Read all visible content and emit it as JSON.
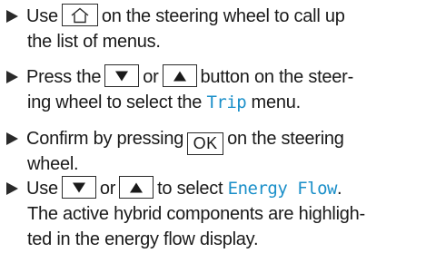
{
  "colors": {
    "text": "#1a1a1a",
    "menu_highlight": "#1a8fc9",
    "bullet": "#2a2a2a"
  },
  "steps": [
    {
      "bullet_icon": "triangle-right-icon",
      "line1_pre": "Use",
      "home_icon": "home-icon",
      "line1_post": "on the steering wheel to call up",
      "line2": "the list of menus."
    },
    {
      "bullet_icon": "triangle-right-icon",
      "line1_pre": "Press the",
      "key_down_icon": "arrow-down-icon",
      "line1_mid": "or",
      "key_up_icon": "arrow-up-icon",
      "line1_post": "button on the steer-",
      "line2_pre": "ing wheel to select the",
      "menu": "Trip",
      "line2_post": "menu."
    },
    {
      "bullet_icon": "triangle-right-icon",
      "line1_pre": "Confirm by pressing",
      "key_label": "OK",
      "line1_post": "on the steering",
      "line2": "wheel."
    },
    {
      "bullet_icon": "triangle-right-icon",
      "line1_pre": "Use",
      "key_down_icon": "arrow-down-icon",
      "line1_mid": "or",
      "key_up_icon": "arrow-up-icon",
      "line1_post": "to select",
      "menu": "Energy Flow",
      "menu_suffix": ".",
      "line2": "The active hybrid components are highligh-",
      "line3": "ted in the energy flow display."
    }
  ]
}
